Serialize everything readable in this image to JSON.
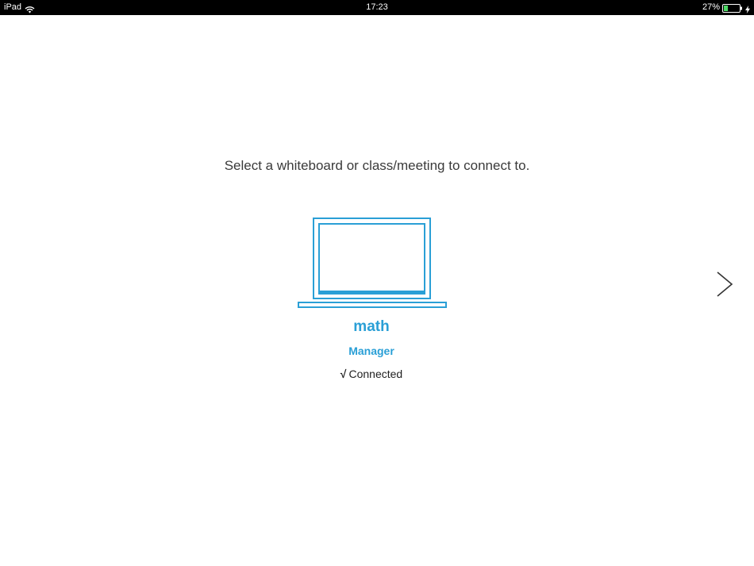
{
  "status_bar": {
    "device": "iPad",
    "time": "17:23",
    "battery_percent": "27%",
    "battery_level": 0.27,
    "icons": [
      "wifi-icon",
      "battery-icon",
      "charging-bolt-icon"
    ]
  },
  "main": {
    "prompt": "Select a whiteboard or class/meeting to connect to.",
    "device": {
      "icon": "laptop-icon",
      "name": "math",
      "role": "Manager",
      "status_check": "√",
      "status": "Connected"
    },
    "next_icon": "chevron-right-icon"
  },
  "colors": {
    "accent": "#2a9fd6",
    "status_bar": "#000000",
    "battery_fill": "#4cd964"
  }
}
